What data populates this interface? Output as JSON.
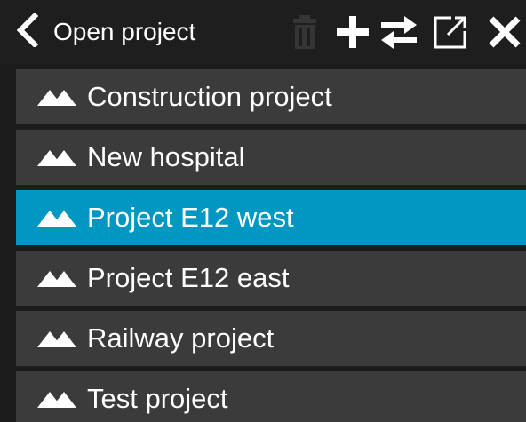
{
  "header": {
    "title": "Open project",
    "icons": {
      "back": "chevron-left-icon",
      "delete": "trash-icon",
      "add": "plus-icon",
      "swap": "swap-arrows-icon",
      "open_external": "external-link-icon",
      "close": "close-icon"
    },
    "delete_enabled": false
  },
  "projects": {
    "icon": "mountain-icon",
    "selected_index": 2,
    "items": [
      {
        "label": "Construction project"
      },
      {
        "label": "New hospital"
      },
      {
        "label": "Project E12 west"
      },
      {
        "label": "Project E12 east"
      },
      {
        "label": "Railway project"
      },
      {
        "label": "Test project"
      }
    ]
  },
  "colors": {
    "background": "#1c1c1c",
    "item": "#3b3b3b",
    "selected": "#0097c2",
    "text": "#ffffff",
    "disabled_icon": "#3a3a3a"
  }
}
